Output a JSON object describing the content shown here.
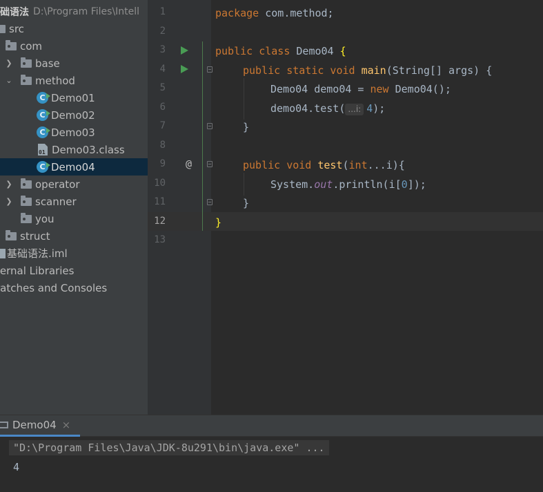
{
  "project_tree": {
    "root": {
      "name": "础语法",
      "path": "D:\\Program Files\\Intell"
    },
    "items": [
      {
        "label": "src"
      },
      {
        "label": "com"
      },
      {
        "label": "base"
      },
      {
        "label": "method"
      },
      {
        "label": "Demo01"
      },
      {
        "label": "Demo02"
      },
      {
        "label": "Demo03"
      },
      {
        "label": "Demo03.class"
      },
      {
        "label": "Demo04"
      },
      {
        "label": "operator"
      },
      {
        "label": "scanner"
      },
      {
        "label": "you"
      },
      {
        "label": "struct"
      },
      {
        "label": "基础语法.iml"
      },
      {
        "label": "ternal Libraries"
      },
      {
        "label": "ratches and Consoles"
      }
    ],
    "selected": "Demo04"
  },
  "editor": {
    "line_numbers": [
      "1",
      "2",
      "3",
      "4",
      "5",
      "6",
      "7",
      "8",
      "9",
      "10",
      "11",
      "12",
      "13"
    ],
    "current_line": "12",
    "code": {
      "l1_kw": "package",
      "l1_rest": " com.method;",
      "l3_kw": "public class",
      "l3_name": " Demo04 ",
      "l3_brace": "{",
      "l4_kw": "public static void",
      "l4_fn": "main",
      "l4_rest": "(String[] args) {",
      "l5_a": "Demo04 demo04 = ",
      "l5_kw": "new",
      "l5_b": " Demo04();",
      "l6_a": "demo04.test(",
      "l6_hint": "...i:",
      "l6_num": "4",
      "l6_b": ");",
      "l7": "}",
      "l9_kw": "public void",
      "l9_fn": "test",
      "l9_paren": "(",
      "l9_kw2": "int",
      "l9_rest": "...i){",
      "l10_a": "System.",
      "l10_static": "out",
      "l10_b": ".println(i[",
      "l10_num": "0",
      "l10_c": "]);",
      "l11": "}",
      "l12": "}"
    },
    "gutter_marker": "@"
  },
  "run_panel": {
    "tab_label": "Demo04",
    "tab_close": "×",
    "command": "\"D:\\Program Files\\Java\\JDK-8u291\\bin\\java.exe\" ...",
    "output": "4"
  },
  "colors": {
    "keyword": "#cc7832",
    "function": "#ffc66d",
    "number": "#6897bb",
    "selection": "#0d293e",
    "run_icon": "#499c54"
  }
}
